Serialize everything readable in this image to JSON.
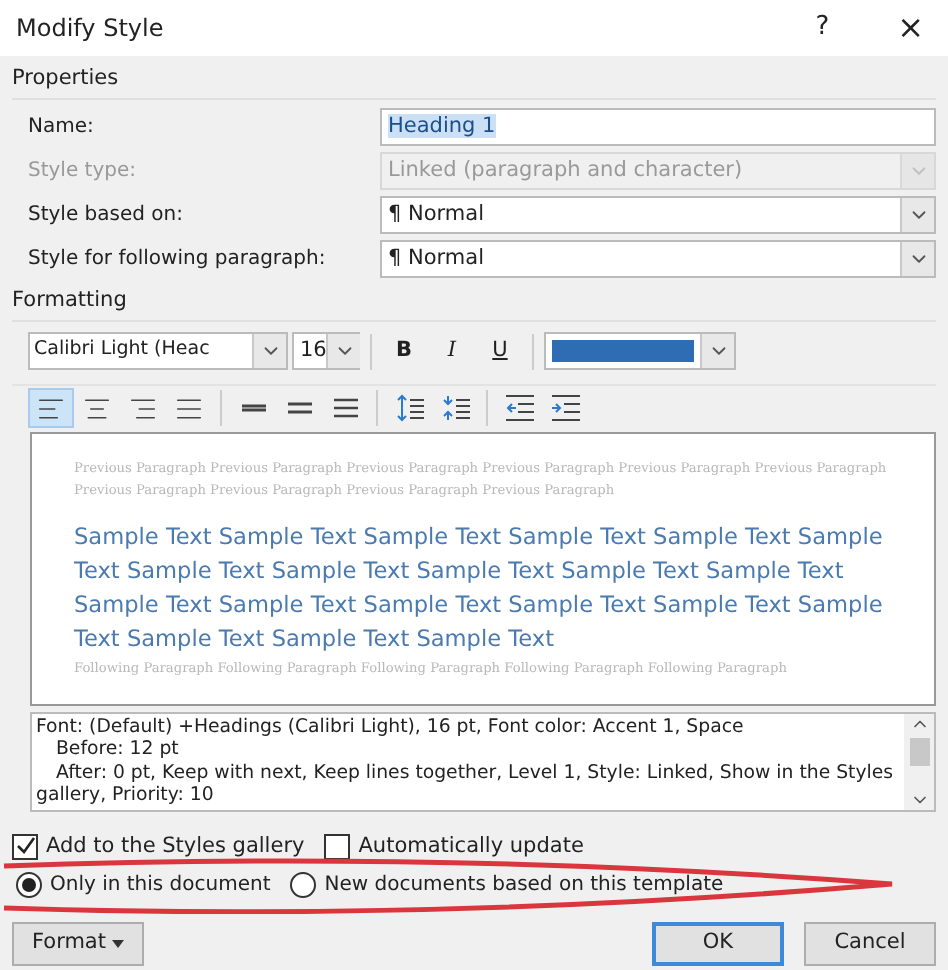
{
  "window": {
    "title": "Modify Style",
    "help": "?",
    "close": "×"
  },
  "properties": {
    "label": "Properties",
    "fields": [
      {
        "label": "Name:",
        "value": "Heading 1",
        "kind": "text",
        "disabled": false,
        "selected_text": true
      },
      {
        "label": "Style type:",
        "value": "Linked (paragraph and character)",
        "kind": "combo",
        "disabled": true,
        "selected_text": false
      },
      {
        "label": "Style based on:",
        "value": "¶ Normal",
        "kind": "combo",
        "disabled": false,
        "selected_text": false
      },
      {
        "label": "Style for following paragraph:",
        "value": "¶ Normal",
        "kind": "combo",
        "disabled": false,
        "selected_text": false
      }
    ]
  },
  "formatting": {
    "label": "Formatting",
    "font": "Calibri Light (Heac",
    "size": "16",
    "bold": "B",
    "italic": "I",
    "underline": "U",
    "paragraph_buttons": [
      {
        "kind": "align-left",
        "selected": true
      },
      {
        "kind": "align-center",
        "selected": false
      },
      {
        "kind": "align-right",
        "selected": false
      },
      {
        "kind": "align-justify",
        "selected": false
      },
      {
        "kind": "single-spacing",
        "selected": false
      },
      {
        "kind": "one-half-spacing",
        "selected": false
      },
      {
        "kind": "double-spacing",
        "selected": false
      },
      {
        "kind": "increase-spacing",
        "selected": false
      },
      {
        "kind": "decrease-spacing",
        "selected": false
      },
      {
        "kind": "decrease-indent",
        "selected": false
      },
      {
        "kind": "increase-indent",
        "selected": false
      }
    ]
  },
  "preview": {
    "previous": "Previous Paragraph Previous Paragraph Previous Paragraph Previous Paragraph Previous Paragraph Previous Paragraph Previous Paragraph Previous Paragraph Previous Paragraph Previous Paragraph",
    "sample": "Sample Text Sample Text Sample Text Sample Text Sample Text Sample Text Sample Text Sample Text Sample Text Sample Text Sample Text Sample Text Sample Text Sample Text Sample Text Sample Text Sample Text Sample Text Sample Text Sample Text",
    "following": "Following Paragraph Following Paragraph Following Paragraph Following Paragraph Following Paragraph"
  },
  "description": [
    "Font: (Default) +Headings (Calibri Light), 16 pt, Font color: Accent 1, Space",
    "Before:  12 pt",
    "After:  0 pt, Keep with next, Keep lines together, Level 1, Style: Linked, Show in the Styles",
    "gallery, Priority: 10"
  ],
  "checkboxes": [
    {
      "label": "Add to the Styles gallery",
      "checked": true
    },
    {
      "label": "Automatically update",
      "checked": false
    }
  ],
  "radios": [
    {
      "label": "Only in this document",
      "selected": true
    },
    {
      "label": "New documents based on this template",
      "selected": false
    }
  ],
  "buttons": {
    "format": "Format",
    "ok": "OK",
    "cancel": "Cancel"
  }
}
